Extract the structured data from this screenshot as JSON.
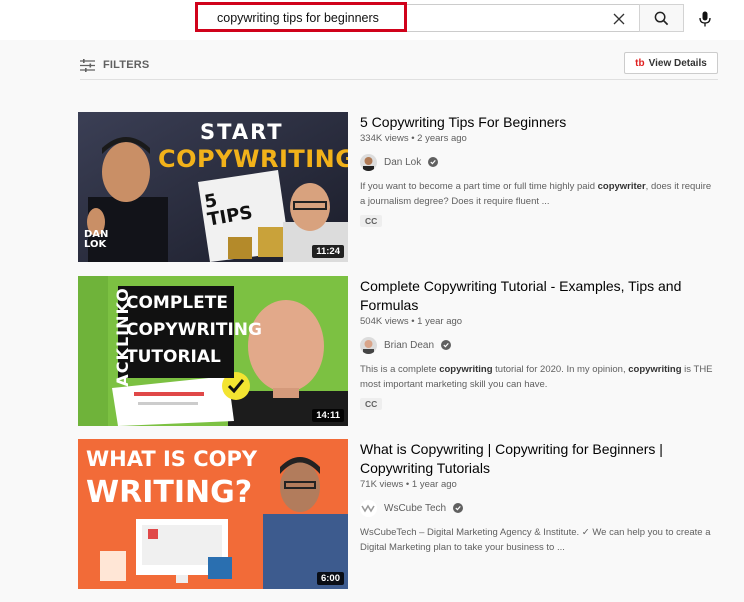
{
  "search": {
    "value": "copywriting tips for beginners",
    "clear_icon": "close-icon",
    "search_icon": "search-icon",
    "mic_icon": "microphone-icon"
  },
  "toolbar": {
    "filters_label": "FILTERS",
    "filters_icon": "sliders-icon",
    "view_details_label": "View Details",
    "view_details_logo": "tb"
  },
  "colors": {
    "highlight": "#d0021b",
    "background": "#f9f9f9",
    "meta_text": "#606060"
  },
  "results": [
    {
      "title": "5 Copywriting Tips For Beginners",
      "views": "334K views",
      "age": "2 years ago",
      "meta": "334K views • 2 years ago",
      "channel": "Dan Lok",
      "verified": true,
      "description": "If you want to become a part time or full time highly paid copywriter, does it require a journalism degree? Does it require fluent ...",
      "badge": "CC",
      "duration": "11:24",
      "thumb_text": {
        "line1": "START",
        "line2": "COPYWRITING",
        "tips_number": "5",
        "tips_word": "TIPS",
        "brand_top": "DAN",
        "brand_bottom": "LOK"
      }
    },
    {
      "title": "Complete Copywriting Tutorial - Examples, Tips and Formulas",
      "views": "504K views",
      "age": "1 year ago",
      "meta": "504K views • 1 year ago",
      "channel": "Brian Dean",
      "verified": true,
      "description": "This is a complete copywriting tutorial for 2020. In my opinion, copywriting is THE most important marketing skill you can have.",
      "badge": "CC",
      "duration": "14:11",
      "thumb_text": {
        "line1": "COMPLETE",
        "line2": "COPYWRITING",
        "line3": "TUTORIAL",
        "side": "BACKLINKO"
      }
    },
    {
      "title": "What is Copywriting | Copywriting for Beginners | Copywriting Tutorials",
      "views": "71K views",
      "age": "1 year ago",
      "meta": "71K views • 1 year ago",
      "channel": "WsCube Tech",
      "verified": true,
      "description": "WsCubeTech – Digital Marketing Agency & Institute. ✓ We can help you to create a Digital Marketing plan to take your business to ...",
      "badge": "",
      "duration": "6:00",
      "thumb_text": {
        "line1": "WHAT IS COPY",
        "line2": "WRITING?"
      }
    }
  ]
}
